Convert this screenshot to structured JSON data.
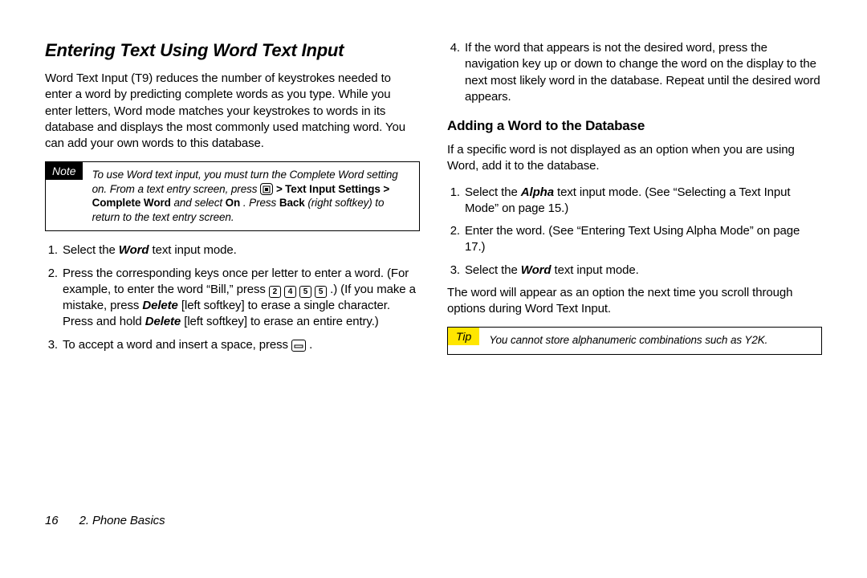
{
  "left": {
    "heading": "Entering Text Using Word Text Input",
    "intro": "Word Text Input (T9) reduces the number of keystrokes needed to enter a word by predicting complete words as you type. While you enter letters, Word mode matches your keystrokes to words in its database and displays the most commonly used matching word. You can add your own words to this database.",
    "note": {
      "label": "Note",
      "parts": {
        "a": "To use Word text input, you must turn the Complete Word setting on. From a text entry screen, press ",
        "b": "Text Input Settings > Complete Word",
        "c": " and select ",
        "d": "On",
        "e": ". Press ",
        "f": "Back",
        "g": " (right softkey) to return to the text entry screen."
      }
    },
    "list": {
      "i1": {
        "num": "1.",
        "a": "Select the ",
        "b": "Word",
        "c": " text input mode."
      },
      "i2": {
        "num": "2.",
        "a": "Press the corresponding keys once per letter to enter a word. (For example, to enter the word “Bill,” press ",
        "k1": "2",
        "k2": "4",
        "k3": "5",
        "k4": "5",
        "b": ".) (If you make a mistake, press ",
        "c": "Delete",
        "d": " [left softkey] to erase a single character. Press and hold ",
        "e": "Delete",
        "f": " [left softkey] to erase an entire entry.)"
      },
      "i3": {
        "num": "3.",
        "a": "To accept a word and insert a space, press",
        "b": "."
      }
    }
  },
  "right": {
    "cont4": {
      "num": "4.",
      "a": "If the word that appears is not the desired word, press the navigation key up or down to change the word on the display to the next most likely word in the database. Repeat until the desired word appears."
    },
    "subheading": "Adding a Word to the Database",
    "intro2": "If a specific word is not displayed as an option when you are using Word, add it to the database.",
    "list2": {
      "i1": {
        "num": "1.",
        "a": "Select the ",
        "b": "Alpha",
        "c": " text input mode. (See “Selecting a Text Input Mode” on page 15.)"
      },
      "i2": {
        "num": "2.",
        "a": "Enter the word. (See “Entering Text Using Alpha Mode” on page 17.)"
      },
      "i3": {
        "num": "3.",
        "a": "Select the ",
        "b": "Word",
        "c": " text input mode."
      }
    },
    "outro": "The word will appear as an option the next time you scroll through options during Word Text Input.",
    "tip": {
      "label": "Tip",
      "text": "You cannot store alphanumeric combinations such as Y2K."
    }
  },
  "footer": {
    "page": "16",
    "chapter": "2. Phone Basics"
  }
}
